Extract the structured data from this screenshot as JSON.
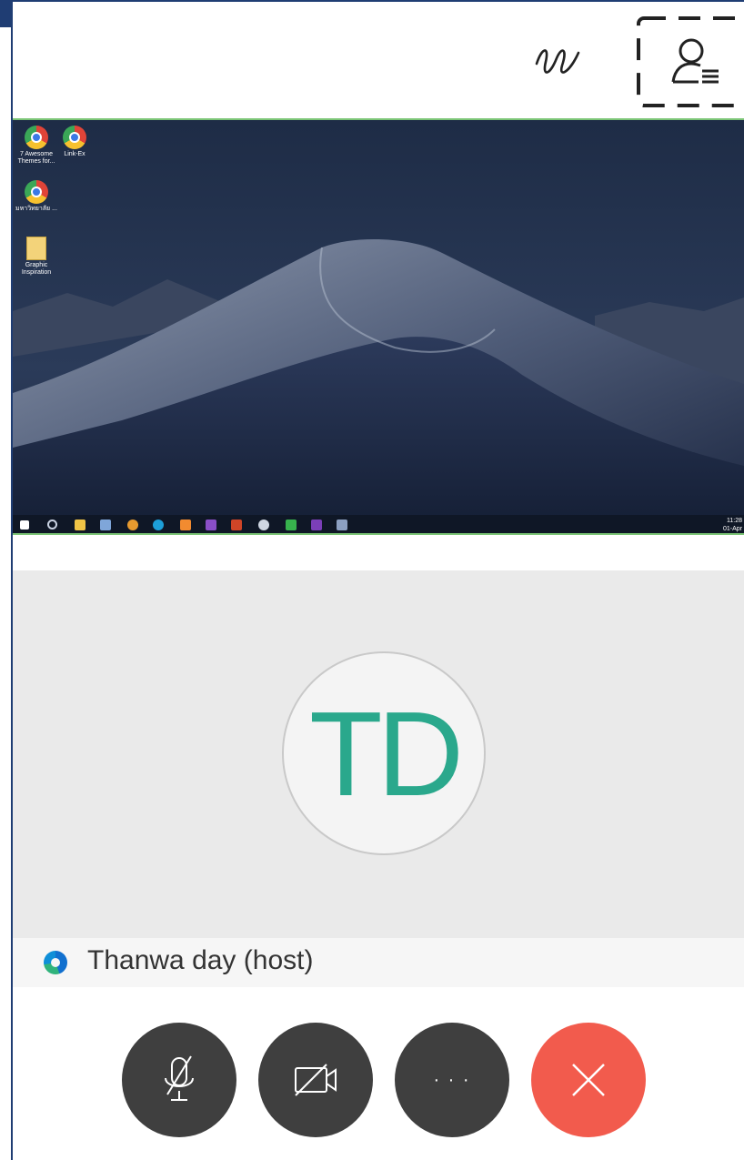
{
  "participant": {
    "initials": "TD",
    "name": "Thanwa day (host)"
  },
  "desktop": {
    "icons": [
      {
        "label": "7 Awesome Themes for..."
      },
      {
        "label": "Link-Ex"
      },
      {
        "label": "มหาวิทยาลัย ..."
      },
      {
        "label": "Graphic Inspiration"
      }
    ],
    "clock_time": "11:28",
    "clock_date": "01-Apr"
  },
  "controls": {
    "more_label": "· · ·"
  },
  "colors": {
    "accent_green": "#2aa88c",
    "end_red": "#f25b4d",
    "control_dark": "#3f3f3f",
    "frame_blue": "#1f3d73"
  },
  "icons": [
    "annotate-icon",
    "participants-icon",
    "mic-muted-icon",
    "video-off-icon",
    "more-icon",
    "close-icon",
    "webex-icon"
  ]
}
